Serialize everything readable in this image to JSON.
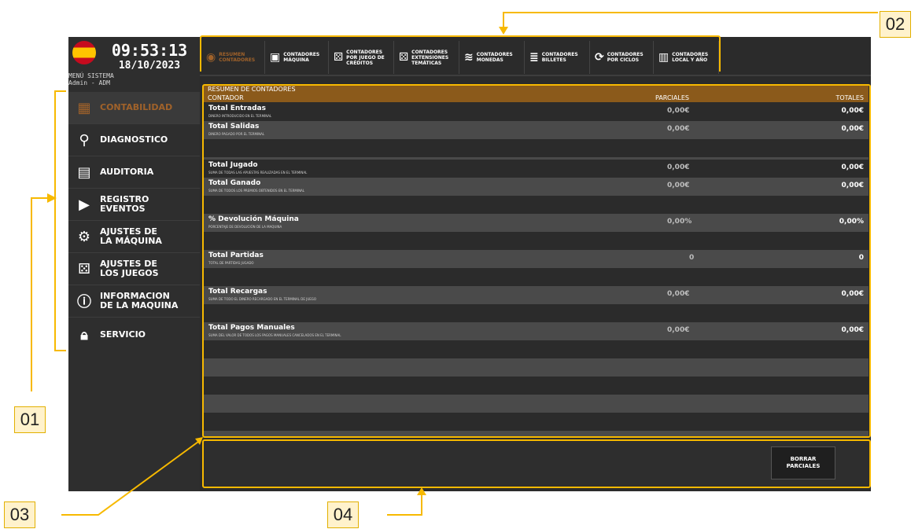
{
  "header": {
    "time": "09:53:13",
    "date": "18/10/2023",
    "menu_system": "MENÚ SISTEMA",
    "user": "Admin - ADM"
  },
  "sidebar": {
    "items": [
      {
        "label": "CONTABILIDAD",
        "icon": "calculator-icon",
        "active": true
      },
      {
        "label": "DIAGNOSTICO",
        "icon": "diagnostic-icon"
      },
      {
        "label": "AUDITORIA",
        "icon": "clipboard-icon"
      },
      {
        "label": "REGISTRO EVENTOS",
        "icon": "camera-icon"
      },
      {
        "label": "AJUSTES DE LA MÁQUINA",
        "icon": "gears-icon"
      },
      {
        "label": "AJUSTES DE LOS JUEGOS",
        "icon": "dice-icon"
      },
      {
        "label": "INFORMACION DE LA MAQUINA",
        "icon": "info-icon"
      },
      {
        "label": "SERVICIO",
        "icon": "lock-icon"
      }
    ]
  },
  "tabs": [
    {
      "label": "RESUMEN CONTADORES",
      "icon": "coins-icon",
      "active": true
    },
    {
      "label": "CONTADORES MÁQUINA",
      "icon": "machine-icon"
    },
    {
      "label": "CONTADORES POR JUEGO DE CRÉDITOS",
      "icon": "dice-icon"
    },
    {
      "label": "CONTADORES EXTENSIONES TEMÁTICAS",
      "icon": "dice-icon"
    },
    {
      "label": "CONTADORES MONEDAS",
      "icon": "coins-stack-icon"
    },
    {
      "label": "CONTADORES BILLETES",
      "icon": "banknotes-icon"
    },
    {
      "label": "CONTADORES POR CICLOS",
      "icon": "cycle-icon"
    },
    {
      "label": "CONTADORES LOCAL Y AÑO",
      "icon": "building-icon"
    }
  ],
  "table": {
    "title": "RESUMEN DE CONTADORES",
    "col_counter": "CONTADOR",
    "col_partial": "PARCIALES",
    "col_total": "TOTALES",
    "rows": [
      {
        "name": "Total Entradas",
        "desc": "DINERO INTRODUCIDO EN EL TERMINAL",
        "partial": "0,00€",
        "total": "0,00€"
      },
      {
        "name": "Total Salidas",
        "desc": "DINERO PAGADO POR EL TERMINAL",
        "partial": "0,00€",
        "total": "0,00€"
      },
      {
        "name": "Total Jugado",
        "desc": "SUMA DE TODAS LAS APUESTAS REALIZADAS EN EL TERMINAL",
        "partial": "0,00€",
        "total": "0,00€"
      },
      {
        "name": "Total Ganado",
        "desc": "SUMA DE TODOS LOS PREMIOS OBTENIDOS EN EL TERMINAL",
        "partial": "0,00€",
        "total": "0,00€"
      },
      {
        "name": "% Devolución Máquina",
        "desc": "PORCENTAJE DE DEVOLUCIÓN DE LA MAQUINA",
        "partial": "0,00%",
        "total": "0,00%"
      },
      {
        "name": "Total Partidas",
        "desc": "TOTAL DE PARTIDAS JUGADO",
        "partial": "0",
        "total": "0"
      },
      {
        "name": "Total Recargas",
        "desc": "SUMA DE TODO EL DINERO RECARGADO EN EL TERMINAL DE JUEGO",
        "partial": "0,00€",
        "total": "0,00€"
      },
      {
        "name": "Total Pagos Manuales",
        "desc": "SUMA DEL VALOR DE TODOS LOS PAGOS MANUALES CANCELADOS EN EL TERMINAL",
        "partial": "0,00€",
        "total": "0,00€"
      }
    ]
  },
  "bottom": {
    "button_label": "BORRAR PARCIALES"
  },
  "callouts": [
    "01",
    "02",
    "03",
    "04"
  ],
  "colors": {
    "accent": "#a0622a",
    "header_bar": "#8b5a1b",
    "highlight": "#f7b900"
  }
}
